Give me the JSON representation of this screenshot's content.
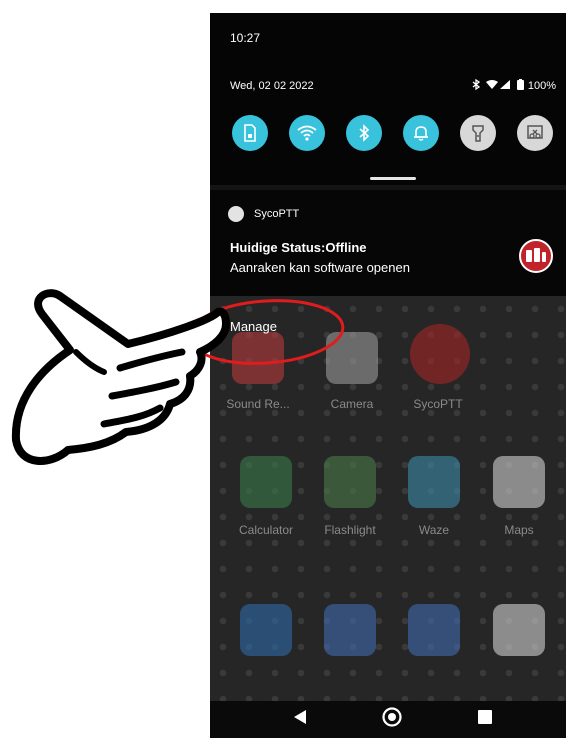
{
  "status_bar": {
    "time": "10:27",
    "date": "Wed, 02 02 2022",
    "battery": "100%"
  },
  "quick_settings": [
    {
      "icon": "sim-card-icon",
      "state": "on"
    },
    {
      "icon": "wifi-icon",
      "state": "on"
    },
    {
      "icon": "bluetooth-icon",
      "state": "on"
    },
    {
      "icon": "bell-icon",
      "state": "on"
    },
    {
      "icon": "flashlight-icon",
      "state": "off"
    },
    {
      "icon": "screenshot-icon",
      "state": "off"
    }
  ],
  "notification": {
    "app_name": "SycoPTT",
    "title": "Huidige Status:Offline",
    "text": "Aanraken kan software openen"
  },
  "manage_label": "Manage",
  "home": {
    "apps_row1": [
      "Sound Re...",
      "Camera",
      "SycoPTT"
    ],
    "apps_row2": [
      "Calculator",
      "Flashlight",
      "Waze",
      "Maps"
    ]
  },
  "colors": {
    "quick_tile_on": "#39c2dc",
    "highlight_ellipse": "#e01c1c"
  }
}
